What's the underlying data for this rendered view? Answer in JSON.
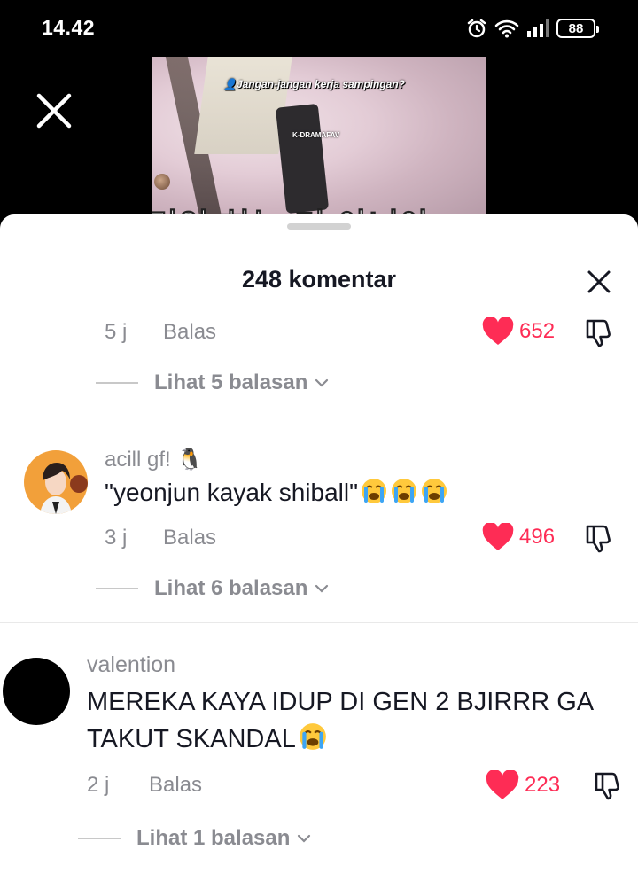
{
  "status_bar": {
    "time": "14.42",
    "battery": "88",
    "icons": [
      "alarm-icon",
      "wifi-icon",
      "signal-icon",
      "battery-icon"
    ]
  },
  "video": {
    "caption": "Jangan-jangan kerja sampingan?",
    "watermark": "K-DRAMAFAV",
    "subtitle": "면인 하는 거 아니야 ㄱ",
    "close_icon": "close-icon"
  },
  "comments_sheet": {
    "title": "248 komentar",
    "close_icon": "close-icon",
    "comments": [
      {
        "time": "5 j",
        "reply_label": "Balas",
        "likes": "652",
        "liked": true,
        "view_replies": "Lihat 5 balasan"
      },
      {
        "username": "acill gf! 🐧",
        "text": "\"yeonjun kayak shiball\"",
        "emoji_count": 3,
        "time": "3 j",
        "reply_label": "Balas",
        "likes": "496",
        "liked": true,
        "view_replies": "Lihat 6 balasan"
      },
      {
        "username": "valention",
        "text_line1": "MEREKA KAYA IDUP DI GEN 2 BJIRRR GA",
        "text_line2": "TAKUT SKANDAL",
        "emoji_count": 1,
        "time": "2 j",
        "reply_label": "Balas",
        "likes": "223",
        "liked": true,
        "view_replies": "Lihat 1 balasan"
      }
    ]
  },
  "colors": {
    "like_red": "#FE2C55",
    "text_primary": "#161823",
    "text_secondary": "#8A8B91"
  }
}
